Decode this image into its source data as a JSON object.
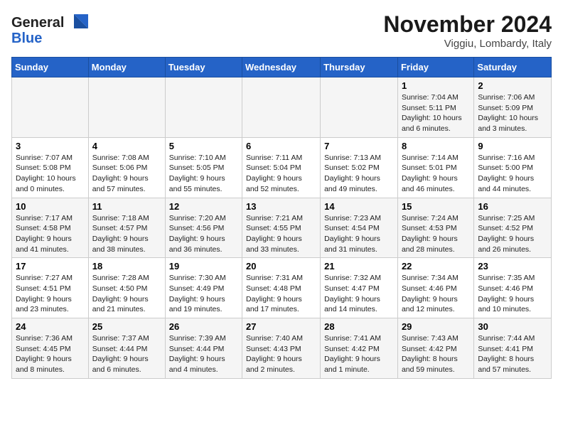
{
  "header": {
    "logo_general": "General",
    "logo_blue": "Blue",
    "month_title": "November 2024",
    "location": "Viggiu, Lombardy, Italy"
  },
  "days_of_week": [
    "Sunday",
    "Monday",
    "Tuesday",
    "Wednesday",
    "Thursday",
    "Friday",
    "Saturday"
  ],
  "weeks": [
    [
      {
        "day": "",
        "info": ""
      },
      {
        "day": "",
        "info": ""
      },
      {
        "day": "",
        "info": ""
      },
      {
        "day": "",
        "info": ""
      },
      {
        "day": "",
        "info": ""
      },
      {
        "day": "1",
        "info": "Sunrise: 7:04 AM\nSunset: 5:11 PM\nDaylight: 10 hours and 6 minutes."
      },
      {
        "day": "2",
        "info": "Sunrise: 7:06 AM\nSunset: 5:09 PM\nDaylight: 10 hours and 3 minutes."
      }
    ],
    [
      {
        "day": "3",
        "info": "Sunrise: 7:07 AM\nSunset: 5:08 PM\nDaylight: 10 hours and 0 minutes."
      },
      {
        "day": "4",
        "info": "Sunrise: 7:08 AM\nSunset: 5:06 PM\nDaylight: 9 hours and 57 minutes."
      },
      {
        "day": "5",
        "info": "Sunrise: 7:10 AM\nSunset: 5:05 PM\nDaylight: 9 hours and 55 minutes."
      },
      {
        "day": "6",
        "info": "Sunrise: 7:11 AM\nSunset: 5:04 PM\nDaylight: 9 hours and 52 minutes."
      },
      {
        "day": "7",
        "info": "Sunrise: 7:13 AM\nSunset: 5:02 PM\nDaylight: 9 hours and 49 minutes."
      },
      {
        "day": "8",
        "info": "Sunrise: 7:14 AM\nSunset: 5:01 PM\nDaylight: 9 hours and 46 minutes."
      },
      {
        "day": "9",
        "info": "Sunrise: 7:16 AM\nSunset: 5:00 PM\nDaylight: 9 hours and 44 minutes."
      }
    ],
    [
      {
        "day": "10",
        "info": "Sunrise: 7:17 AM\nSunset: 4:58 PM\nDaylight: 9 hours and 41 minutes."
      },
      {
        "day": "11",
        "info": "Sunrise: 7:18 AM\nSunset: 4:57 PM\nDaylight: 9 hours and 38 minutes."
      },
      {
        "day": "12",
        "info": "Sunrise: 7:20 AM\nSunset: 4:56 PM\nDaylight: 9 hours and 36 minutes."
      },
      {
        "day": "13",
        "info": "Sunrise: 7:21 AM\nSunset: 4:55 PM\nDaylight: 9 hours and 33 minutes."
      },
      {
        "day": "14",
        "info": "Sunrise: 7:23 AM\nSunset: 4:54 PM\nDaylight: 9 hours and 31 minutes."
      },
      {
        "day": "15",
        "info": "Sunrise: 7:24 AM\nSunset: 4:53 PM\nDaylight: 9 hours and 28 minutes."
      },
      {
        "day": "16",
        "info": "Sunrise: 7:25 AM\nSunset: 4:52 PM\nDaylight: 9 hours and 26 minutes."
      }
    ],
    [
      {
        "day": "17",
        "info": "Sunrise: 7:27 AM\nSunset: 4:51 PM\nDaylight: 9 hours and 23 minutes."
      },
      {
        "day": "18",
        "info": "Sunrise: 7:28 AM\nSunset: 4:50 PM\nDaylight: 9 hours and 21 minutes."
      },
      {
        "day": "19",
        "info": "Sunrise: 7:30 AM\nSunset: 4:49 PM\nDaylight: 9 hours and 19 minutes."
      },
      {
        "day": "20",
        "info": "Sunrise: 7:31 AM\nSunset: 4:48 PM\nDaylight: 9 hours and 17 minutes."
      },
      {
        "day": "21",
        "info": "Sunrise: 7:32 AM\nSunset: 4:47 PM\nDaylight: 9 hours and 14 minutes."
      },
      {
        "day": "22",
        "info": "Sunrise: 7:34 AM\nSunset: 4:46 PM\nDaylight: 9 hours and 12 minutes."
      },
      {
        "day": "23",
        "info": "Sunrise: 7:35 AM\nSunset: 4:46 PM\nDaylight: 9 hours and 10 minutes."
      }
    ],
    [
      {
        "day": "24",
        "info": "Sunrise: 7:36 AM\nSunset: 4:45 PM\nDaylight: 9 hours and 8 minutes."
      },
      {
        "day": "25",
        "info": "Sunrise: 7:37 AM\nSunset: 4:44 PM\nDaylight: 9 hours and 6 minutes."
      },
      {
        "day": "26",
        "info": "Sunrise: 7:39 AM\nSunset: 4:44 PM\nDaylight: 9 hours and 4 minutes."
      },
      {
        "day": "27",
        "info": "Sunrise: 7:40 AM\nSunset: 4:43 PM\nDaylight: 9 hours and 2 minutes."
      },
      {
        "day": "28",
        "info": "Sunrise: 7:41 AM\nSunset: 4:42 PM\nDaylight: 9 hours and 1 minute."
      },
      {
        "day": "29",
        "info": "Sunrise: 7:43 AM\nSunset: 4:42 PM\nDaylight: 8 hours and 59 minutes."
      },
      {
        "day": "30",
        "info": "Sunrise: 7:44 AM\nSunset: 4:41 PM\nDaylight: 8 hours and 57 minutes."
      }
    ]
  ]
}
